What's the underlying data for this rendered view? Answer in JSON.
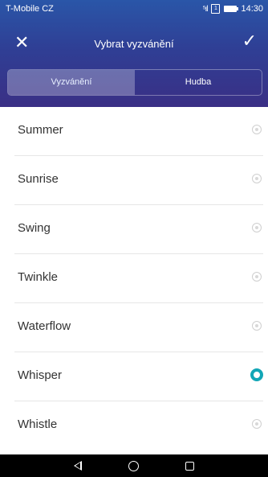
{
  "status_bar": {
    "carrier": "T-Mobile CZ",
    "time": "14:30",
    "signal": "⁵ıl",
    "sim": "1"
  },
  "header": {
    "title": "Vybrat vyzvánění",
    "close_icon": "close-icon",
    "confirm_icon": "check-icon"
  },
  "tabs": [
    {
      "label": "Vyzvánění",
      "active": true
    },
    {
      "label": "Hudba",
      "active": false
    }
  ],
  "ringtones": [
    {
      "name": "Summer",
      "selected": false
    },
    {
      "name": "Sunrise",
      "selected": false
    },
    {
      "name": "Swing",
      "selected": false
    },
    {
      "name": "Twinkle",
      "selected": false
    },
    {
      "name": "Waterflow",
      "selected": false
    },
    {
      "name": "Whisper",
      "selected": true
    },
    {
      "name": "Whistle",
      "selected": false
    }
  ],
  "colors": {
    "accent": "#12a6b6",
    "header_top": "#2a56a8",
    "header_bottom": "#3a2f85"
  }
}
